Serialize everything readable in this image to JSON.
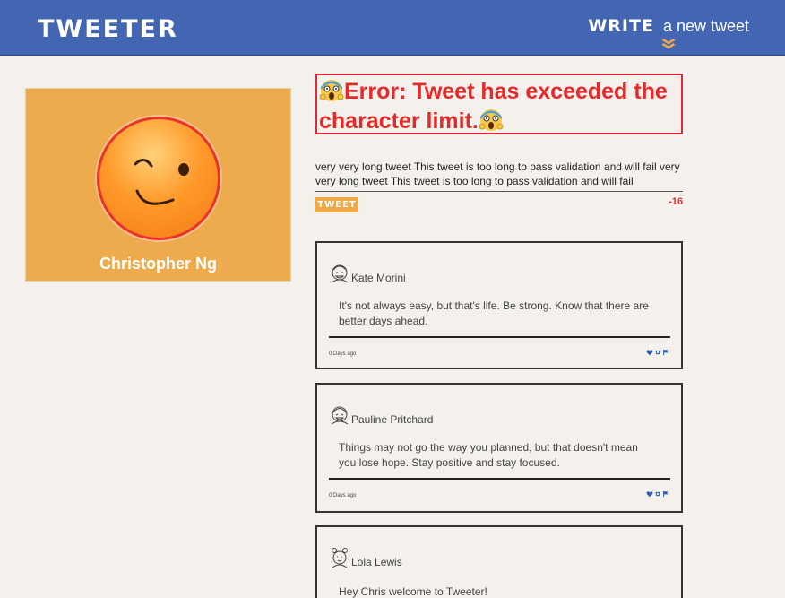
{
  "nav": {
    "brand": "TWEETER",
    "compose_toggle": {
      "bold_word": "WRITE",
      "rest": "a new tweet",
      "icon": "double-chevron-down-icon"
    }
  },
  "profile": {
    "name": "Christopher Ng",
    "avatar": "winking-face-avatar"
  },
  "error": {
    "message": "Error: Tweet has exceeded the character limit.",
    "emoji": "screaming-face-icon"
  },
  "compose": {
    "text": "very very long tweet This tweet is too long to pass validation and will fail very very long tweet This tweet is too long to pass validation and will fail",
    "button_label": "TWEET",
    "counter": "-16"
  },
  "tweets": [
    {
      "user": "Kate Morini",
      "text": "It's not always easy, but that's life. Be strong. Know that there are better days ahead.",
      "date": "0 Days ago"
    },
    {
      "user": "Pauline Pritchard",
      "text": "Things may not go the way you planned, but that doesn't mean you lose hope. Stay positive and stay focused.",
      "date": "0 Days ago"
    },
    {
      "user": "Lola Lewis",
      "text": "Hey Chris welcome to Tweeter!",
      "date": ""
    }
  ],
  "colors": {
    "nav_bg": "#4266b2",
    "accent": "#f0a846",
    "error": "#e52a2a",
    "action_blue": "#2a5db0"
  }
}
